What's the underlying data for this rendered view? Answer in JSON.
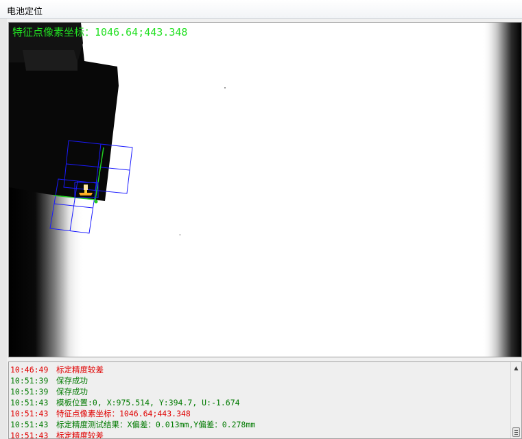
{
  "window": {
    "title": "电池定位"
  },
  "viewer": {
    "overlay_label": "特征点像素坐标：1046.64;443.348"
  },
  "log": {
    "entries": [
      {
        "time": "10:46:49",
        "message": "标定精度较差",
        "level": "error"
      },
      {
        "time": "10:51:39",
        "message": "保存成功",
        "level": "ok"
      },
      {
        "time": "10:51:39",
        "message": "保存成功",
        "level": "ok"
      },
      {
        "time": "10:51:43",
        "message": "模板位置:0, X:975.514, Y:394.7, U:-1.674",
        "level": "ok"
      },
      {
        "time": "10:51:43",
        "message": "特征点像素坐标：1046.64;443.348",
        "level": "error"
      },
      {
        "time": "10:51:43",
        "message": "标定精度测试结果：X偏差：0.013mm,Y偏差：0.278mm",
        "level": "ok"
      },
      {
        "time": "10:51:43",
        "message": "标定精度较差",
        "level": "error"
      }
    ]
  },
  "colors": {
    "overlay_text": "#22e022",
    "log_error": "#e00000",
    "log_ok": "#007a00",
    "grid_lines": "#1a1aff",
    "edge_highlight": "#22cc22",
    "feature_marker": "#ffcc33"
  },
  "icons": {
    "scroll_up": "scroll-up-arrow-icon",
    "scroll_thumb": "scroll-thumb-grip-icon"
  }
}
